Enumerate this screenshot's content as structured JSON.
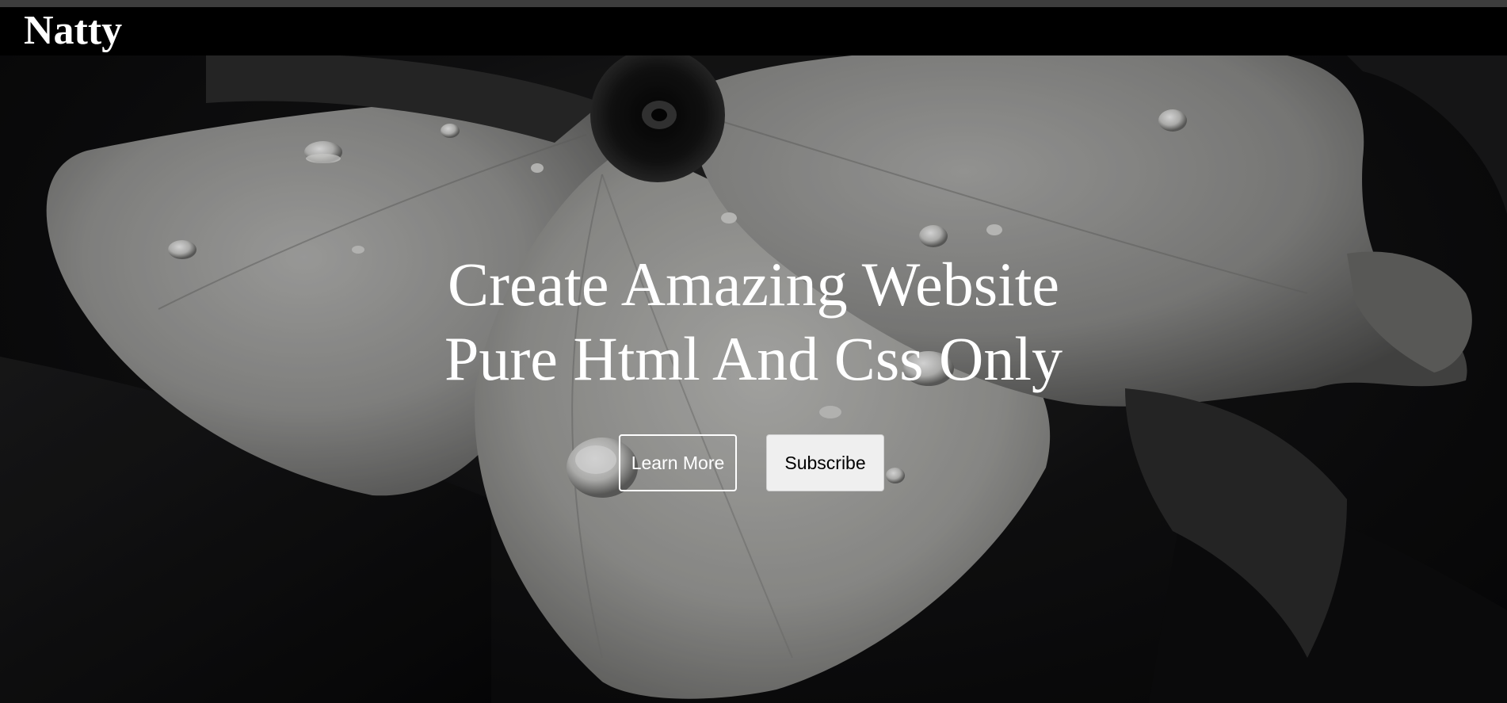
{
  "navbar": {
    "brand": "Natty"
  },
  "hero": {
    "title_line1": "Create Amazing Website",
    "title_line2": "Pure Html And Css Only",
    "learn_more_label": "Learn More",
    "subscribe_label": "Subscribe",
    "background_image": "black-and-white flower with water droplets"
  },
  "colors": {
    "navbar_bg": "#000000",
    "text": "#ffffff",
    "subscribe_bg": "#efefef"
  }
}
